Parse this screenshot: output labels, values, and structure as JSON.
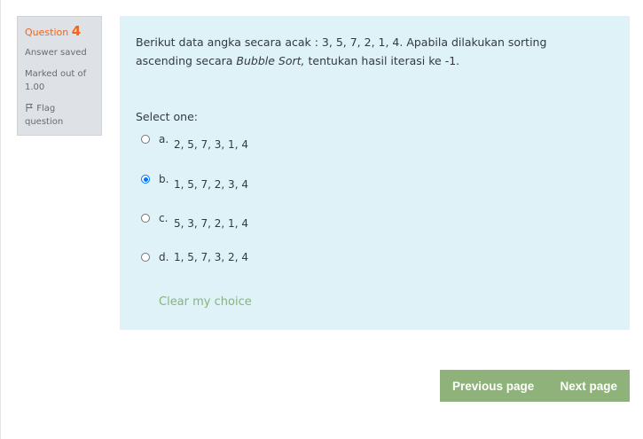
{
  "question_info": {
    "label": "Question ",
    "number": "4",
    "state": "Answer saved",
    "grade_line1": "Marked out of",
    "grade_line2": "1.00",
    "flag_line1": "Flag",
    "flag_line2": "question"
  },
  "question": {
    "text_part1": "Berikut data angka secara acak : 3, 5, 7, 2, 1, 4. Apabila dilakukan sorting ascending secara ",
    "text_emphasis": "Bubble Sort,",
    "text_part2": " tentukan hasil iterasi ke -1.",
    "prompt": "Select one:",
    "options": [
      {
        "letter": "a.",
        "text": "2, 5, 7, 3, 1, 4",
        "selected": false
      },
      {
        "letter": "b.",
        "text": "1, 5, 7, 2, 3, 4",
        "selected": true
      },
      {
        "letter": "c.",
        "text": "5, 3, 7, 2, 1, 4",
        "selected": false
      },
      {
        "letter": "d.",
        "text": "1, 5, 7, 3, 2, 4",
        "selected": false
      }
    ],
    "clear_label": "Clear my choice"
  },
  "navigation": {
    "previous_label": "Previous page",
    "next_label": "Next page"
  },
  "colors": {
    "question_number": "#f4641a",
    "content_background": "#def2f8",
    "accent_green": "#8eb27a",
    "radio_selected": "#0075ff"
  },
  "icons": {
    "flag": "flag-icon"
  }
}
